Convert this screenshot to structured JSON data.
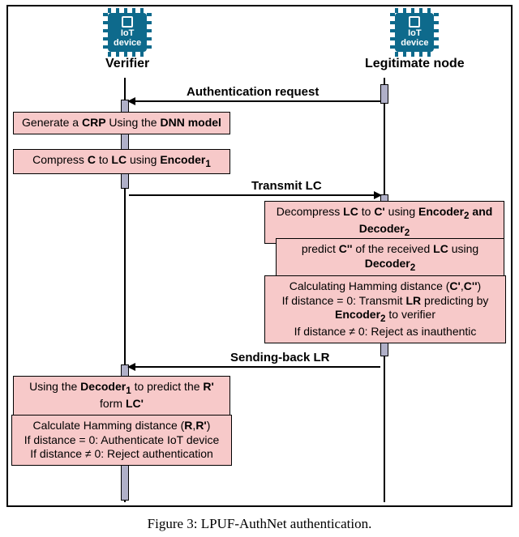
{
  "actors": {
    "verifier": {
      "chip_text": "IoT\ndevice",
      "label": "Verifier"
    },
    "legitimate": {
      "chip_text": "IoT\ndevice",
      "label": "Legitimate node"
    }
  },
  "messages": {
    "auth_request": "Authentication request",
    "transmit_lc": "Transmit LC",
    "send_lr": "Sending-back LR"
  },
  "steps": {
    "v1": "Generate a <b>CRP</b> Using the <b>DNN model</b>",
    "v2": "Compress <b>C</b> to <b>LC</b> using <b>Encoder<sub>1</sub></b>",
    "l1": "Decompress <b>LC</b> to <b>C'</b> using <b>Encoder<sub>2</sub> and Decoder<sub>2</sub></b>",
    "l2": "predict <b>C''</b> of the received <b>LC</b> using <b>Decoder<sub>2</sub></b>",
    "l3": "Calculating Hamming distance (<b>C'</b>,<b>C''</b>)<br>If distance = 0: Transmit <b>LR</b> predicting by <b>Encoder<sub>2</sub></b> to verifier<br>If distance ≠ 0: Reject as inauthentic",
    "v3": "Using the <b>Decoder<sub>1</sub></b> to predict the <b>R'</b> form <b>LC'</b>",
    "v4": "Calculate Hamming distance (<b>R</b>,<b>R'</b>)<br>If distance = 0: Authenticate IoT device<br>If distance ≠ 0: Reject authentication"
  },
  "caption": "Figure 3: LPUF-AuthNet authentication.",
  "colors": {
    "chip": "#0e6a8c",
    "box": "#f7c9c9"
  },
  "chart_data": {
    "type": "sequence_diagram",
    "participants": [
      "Verifier",
      "Legitimate node"
    ],
    "events": [
      {
        "type": "message",
        "from": "Legitimate node",
        "to": "Verifier",
        "label": "Authentication request"
      },
      {
        "type": "action",
        "at": "Verifier",
        "text": "Generate a CRP Using the DNN model"
      },
      {
        "type": "action",
        "at": "Verifier",
        "text": "Compress C to LC using Encoder1"
      },
      {
        "type": "message",
        "from": "Verifier",
        "to": "Legitimate node",
        "label": "Transmit LC"
      },
      {
        "type": "action",
        "at": "Legitimate node",
        "text": "Decompress LC to C' using Encoder2 and Decoder2"
      },
      {
        "type": "action",
        "at": "Legitimate node",
        "text": "predict C'' of the received LC using Decoder2"
      },
      {
        "type": "action",
        "at": "Legitimate node",
        "text": "Calculating Hamming distance (C',C''); If distance = 0: Transmit LR predicting by Encoder2 to verifier; If distance ≠ 0: Reject as inauthentic"
      },
      {
        "type": "message",
        "from": "Legitimate node",
        "to": "Verifier",
        "label": "Sending-back LR"
      },
      {
        "type": "action",
        "at": "Verifier",
        "text": "Using the Decoder1 to predict the R' form LC'"
      },
      {
        "type": "action",
        "at": "Verifier",
        "text": "Calculate Hamming distance (R,R'); If distance = 0: Authenticate IoT device; If distance ≠ 0: Reject authentication"
      }
    ]
  }
}
